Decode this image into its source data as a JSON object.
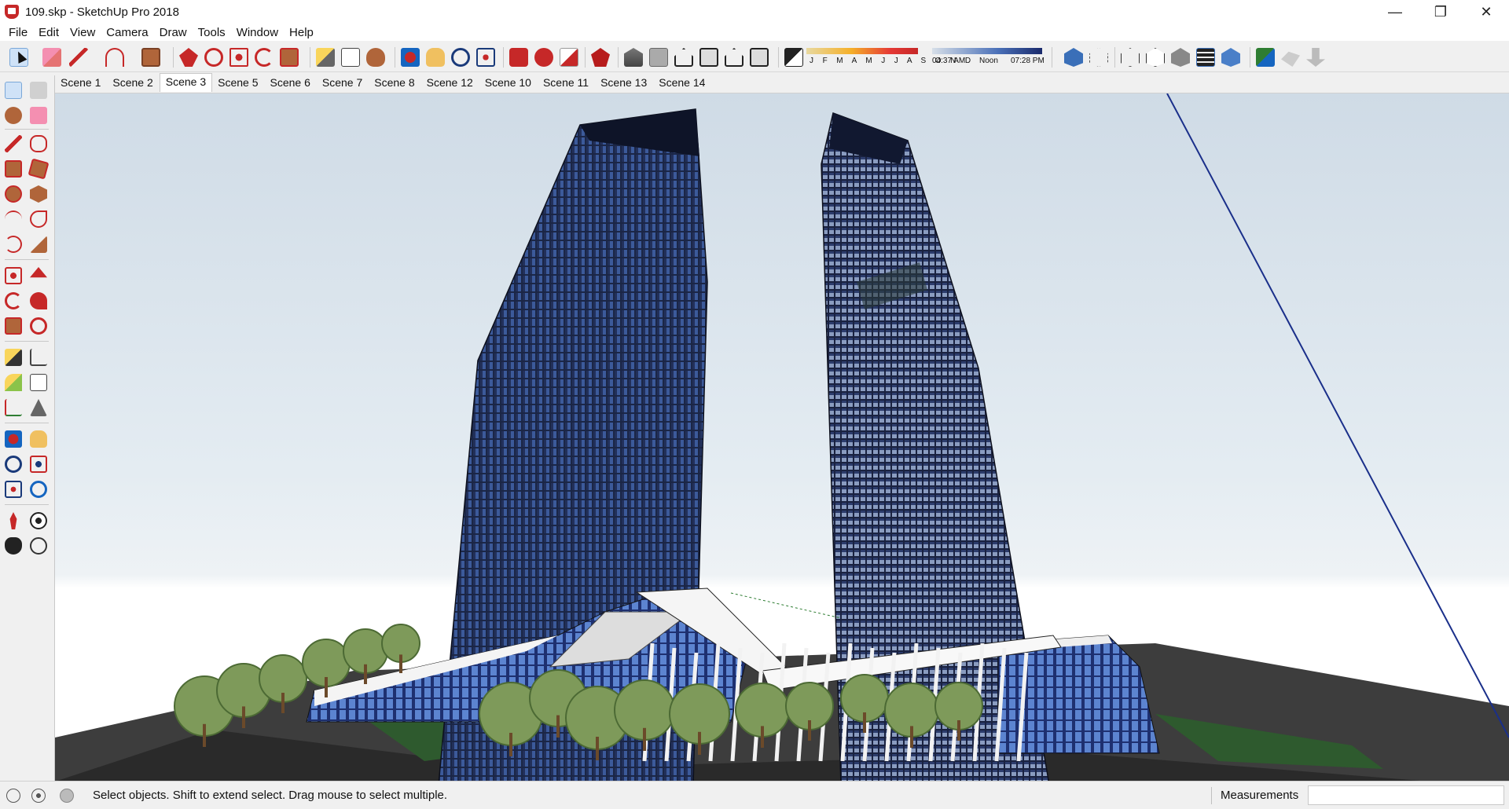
{
  "window": {
    "title": "109.skp - SketchUp Pro 2018",
    "minimize_glyph": "—",
    "maximize_glyph": "❐",
    "close_glyph": "✕"
  },
  "menu": [
    "File",
    "Edit",
    "View",
    "Camera",
    "Draw",
    "Tools",
    "Window",
    "Help"
  ],
  "shadow_settings": {
    "months": "J F M A M J J A S O N D",
    "sunrise": "04:37 AM",
    "noon": "Noon",
    "sunset": "07:28 PM"
  },
  "scenes": {
    "tabs": [
      "Scene 1",
      "Scene 2",
      "Scene 3",
      "Scene 5",
      "Scene 6",
      "Scene 7",
      "Scene 8",
      "Scene 12",
      "Scene 10",
      "Scene 11",
      "Scene 13",
      "Scene 14"
    ],
    "active_index": 2
  },
  "status": {
    "hint": "Select objects. Shift to extend select. Drag mouse to select multiple.",
    "measurements_label": "Measurements",
    "measurements_value": ""
  },
  "colors": {
    "accent_blue": "#3a5aa8",
    "sketchup_red": "#c62828",
    "tower_glass": "#24325e",
    "tree_green": "#7e9a5a"
  },
  "icons": {
    "toolbar": [
      "select-icon",
      "eraser-icon",
      "pencil-icon",
      "arc-icon",
      "rectangle-icon",
      "push-pull-icon",
      "follow-me-icon",
      "move-icon",
      "rotate-icon",
      "scale-icon",
      "tape-measure-icon",
      "text-icon",
      "paint-bucket-icon",
      "orbit-icon",
      "pan-icon",
      "zoom-icon",
      "zoom-extents-icon",
      "warehouse-icon",
      "extension-warehouse-icon",
      "layout-icon",
      "ruby-icon"
    ],
    "views": [
      "iso-view-icon",
      "top-view-icon",
      "front-view-icon",
      "right-view-icon",
      "back-view-icon",
      "left-view-icon"
    ],
    "styles": [
      "xray-icon",
      "back-edges-icon",
      "wireframe-icon",
      "hidden-line-icon",
      "shaded-icon",
      "shaded-textures-icon",
      "monochrome-icon"
    ]
  }
}
